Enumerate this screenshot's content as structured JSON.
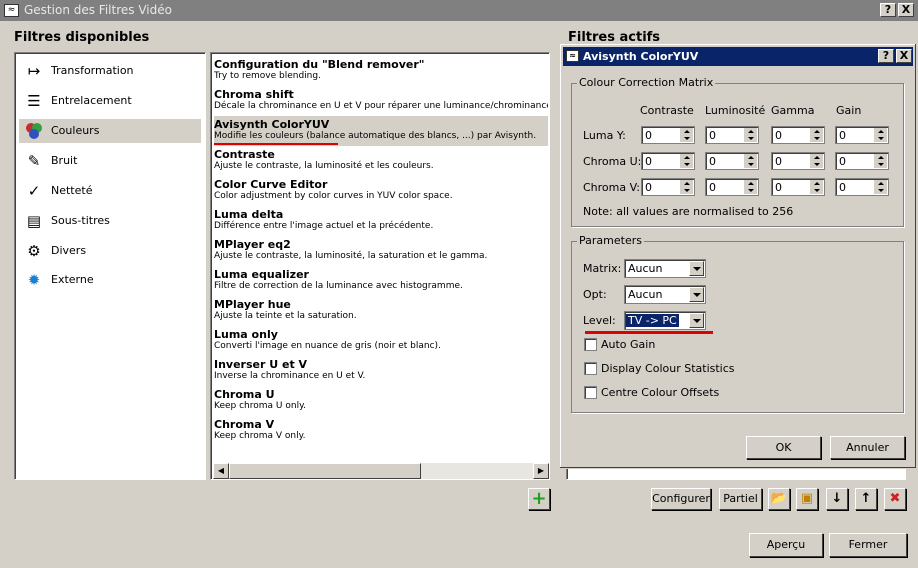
{
  "window": {
    "title": "Gestion des Filtres Vidéo",
    "help_label": "?",
    "close_label": "X"
  },
  "available": {
    "heading": "Filtres disponibles"
  },
  "active": {
    "heading": "Filtres actifs"
  },
  "categories": [
    {
      "label": "Transformation",
      "icon": "transform-icon"
    },
    {
      "label": "Entrelacement",
      "icon": "interlace-icon"
    },
    {
      "label": "Couleurs",
      "icon": "colors-icon"
    },
    {
      "label": "Bruit",
      "icon": "noise-icon"
    },
    {
      "label": "Netteté",
      "icon": "sharpness-icon"
    },
    {
      "label": "Sous-titres",
      "icon": "subtitles-icon"
    },
    {
      "label": "Divers",
      "icon": "misc-icon"
    },
    {
      "label": "Externe",
      "icon": "external-icon"
    }
  ],
  "filters": [
    {
      "name": "Configuration du \"Blend remover\"",
      "desc": "Try to remove blending."
    },
    {
      "name": "Chroma shift",
      "desc": "Décale la chrominance en U et V pour réparer une luminance/chrominance mal sy"
    },
    {
      "name": "Avisynth ColorYUV",
      "desc": "Modifie les couleurs (balance automatique des blancs, ...) par Avisynth."
    },
    {
      "name": "Contraste",
      "desc": "Ajuste le contraste, la luminosité et les couleurs."
    },
    {
      "name": "Color Curve Editor",
      "desc": "Color adjustment by color curves in YUV color space."
    },
    {
      "name": "Luma delta",
      "desc": "Différence entre l'image actuel et la précédente."
    },
    {
      "name": "MPlayer eq2",
      "desc": "Ajuste le contraste, la luminosité, la saturation et le gamma."
    },
    {
      "name": "Luma equalizer",
      "desc": "Filtre de correction de la luminance avec histogramme."
    },
    {
      "name": "MPlayer hue",
      "desc": "Ajuste la teinte et la saturation."
    },
    {
      "name": "Luma only",
      "desc": "Converti l'image en nuance de gris (noir et blanc)."
    },
    {
      "name": "Inverser U et V",
      "desc": "Inverse la chrominance en U et V."
    },
    {
      "name": "Chroma U",
      "desc": "Keep chroma U only."
    },
    {
      "name": "Chroma V",
      "desc": "Keep chroma V only."
    }
  ],
  "dialog": {
    "title": "Avisynth ColorYUV",
    "help_label": "?",
    "close_label": "X",
    "matrix_group": "Colour Correction Matrix",
    "columns": [
      "Contraste",
      "Luminosité",
      "Gamma",
      "Gain"
    ],
    "rows": [
      {
        "label": "Luma Y:",
        "values": [
          "0",
          "0",
          "0",
          "0"
        ]
      },
      {
        "label": "Chroma U:",
        "values": [
          "0",
          "0",
          "0",
          "0"
        ]
      },
      {
        "label": "Chroma V:",
        "values": [
          "0",
          "0",
          "0",
          "0"
        ]
      }
    ],
    "note": "Note: all values are normalised to 256",
    "params_group": "Parameters",
    "matrix_label": "Matrix:",
    "matrix_value": "Aucun",
    "opt_label": "Opt:",
    "opt_value": "Aucun",
    "level_label": "Level:",
    "level_value": "TV -> PC",
    "auto_gain": "Auto Gain",
    "display_stats": "Display Colour Statistics",
    "centre_offsets": "Centre Colour Offsets",
    "ok": "OK",
    "cancel": "Annuler"
  },
  "toolbar": {
    "configure": "Configurer",
    "partial": "Partiel",
    "preview": "Aperçu",
    "close": "Fermer"
  },
  "colors": {
    "annotation_red": "#e00000",
    "selection_blue": "#0a246a",
    "dialog_title": "#0a246a"
  }
}
